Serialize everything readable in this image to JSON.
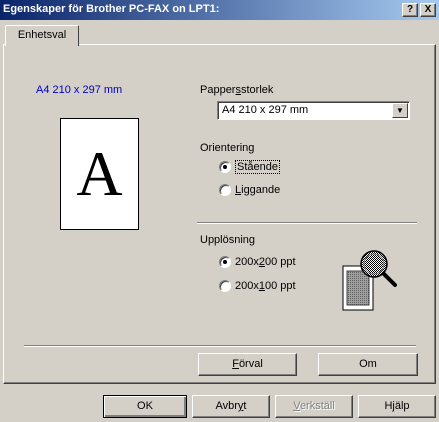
{
  "window": {
    "title": "Egenskaper för Brother PC-FAX on LPT1:"
  },
  "titlebar_buttons": {
    "help": "?",
    "close": "X"
  },
  "tabs": [
    {
      "label": "Enhetsval",
      "active": true
    }
  ],
  "preview": {
    "caption": "A4 210 x 297 mm",
    "letter": "A"
  },
  "paper_size": {
    "label_pre": "Papper",
    "label_key": "s",
    "label_post": "storlek",
    "selected": "A4 210 x 297 mm"
  },
  "orientation": {
    "label": "Orientering",
    "options": [
      {
        "pre": "Stående",
        "key": "",
        "post": "",
        "checked": true
      },
      {
        "pre": "",
        "key": "L",
        "post": "iggande",
        "checked": false
      }
    ]
  },
  "resolution": {
    "label": "Upplösning",
    "options": [
      {
        "pre": "200x",
        "key": "2",
        "post": "00 ppt",
        "checked": true
      },
      {
        "pre": "200x",
        "key": "1",
        "post": "00 ppt",
        "checked": false
      }
    ]
  },
  "panel_buttons": {
    "default": {
      "key": "F",
      "rest": "örval"
    },
    "about": "Om"
  },
  "dialog_buttons": {
    "ok": "OK",
    "cancel": {
      "pre": "Avbr",
      "key": "y",
      "post": "t"
    },
    "apply": {
      "key": "V",
      "rest": "erkställ",
      "disabled": true
    },
    "help": "Hjälp"
  },
  "colors": {
    "title_start": "#0a246a",
    "title_end": "#a6caf0",
    "caption": "#0000cc",
    "face": "#d4d0c8"
  }
}
